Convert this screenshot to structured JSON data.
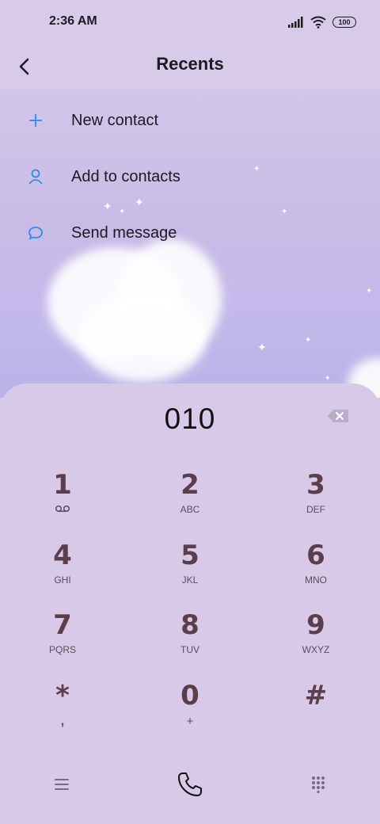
{
  "status": {
    "time": "2:36 AM",
    "battery": "100"
  },
  "header": {
    "title": "Recents"
  },
  "menu": [
    {
      "label": "New contact",
      "icon": "plus-icon"
    },
    {
      "label": "Add to contacts",
      "icon": "person-icon"
    },
    {
      "label": "Send message",
      "icon": "message-icon"
    }
  ],
  "dialer": {
    "number": "010",
    "keys": [
      {
        "digit": "1",
        "sub": "voicemail-icon"
      },
      {
        "digit": "2",
        "sub": "ABC"
      },
      {
        "digit": "3",
        "sub": "DEF"
      },
      {
        "digit": "4",
        "sub": "GHI"
      },
      {
        "digit": "5",
        "sub": "JKL"
      },
      {
        "digit": "6",
        "sub": "MNO"
      },
      {
        "digit": "7",
        "sub": "PQRS"
      },
      {
        "digit": "8",
        "sub": "TUV"
      },
      {
        "digit": "9",
        "sub": "WXYZ"
      },
      {
        "digit": "*",
        "sub": ","
      },
      {
        "digit": "0",
        "sub": "+"
      },
      {
        "digit": "#",
        "sub": ""
      }
    ]
  },
  "colors": {
    "accent": "#2d8cf0",
    "key_digit": "#5a3e4c",
    "dialer_bg": "#d8c9e9"
  }
}
